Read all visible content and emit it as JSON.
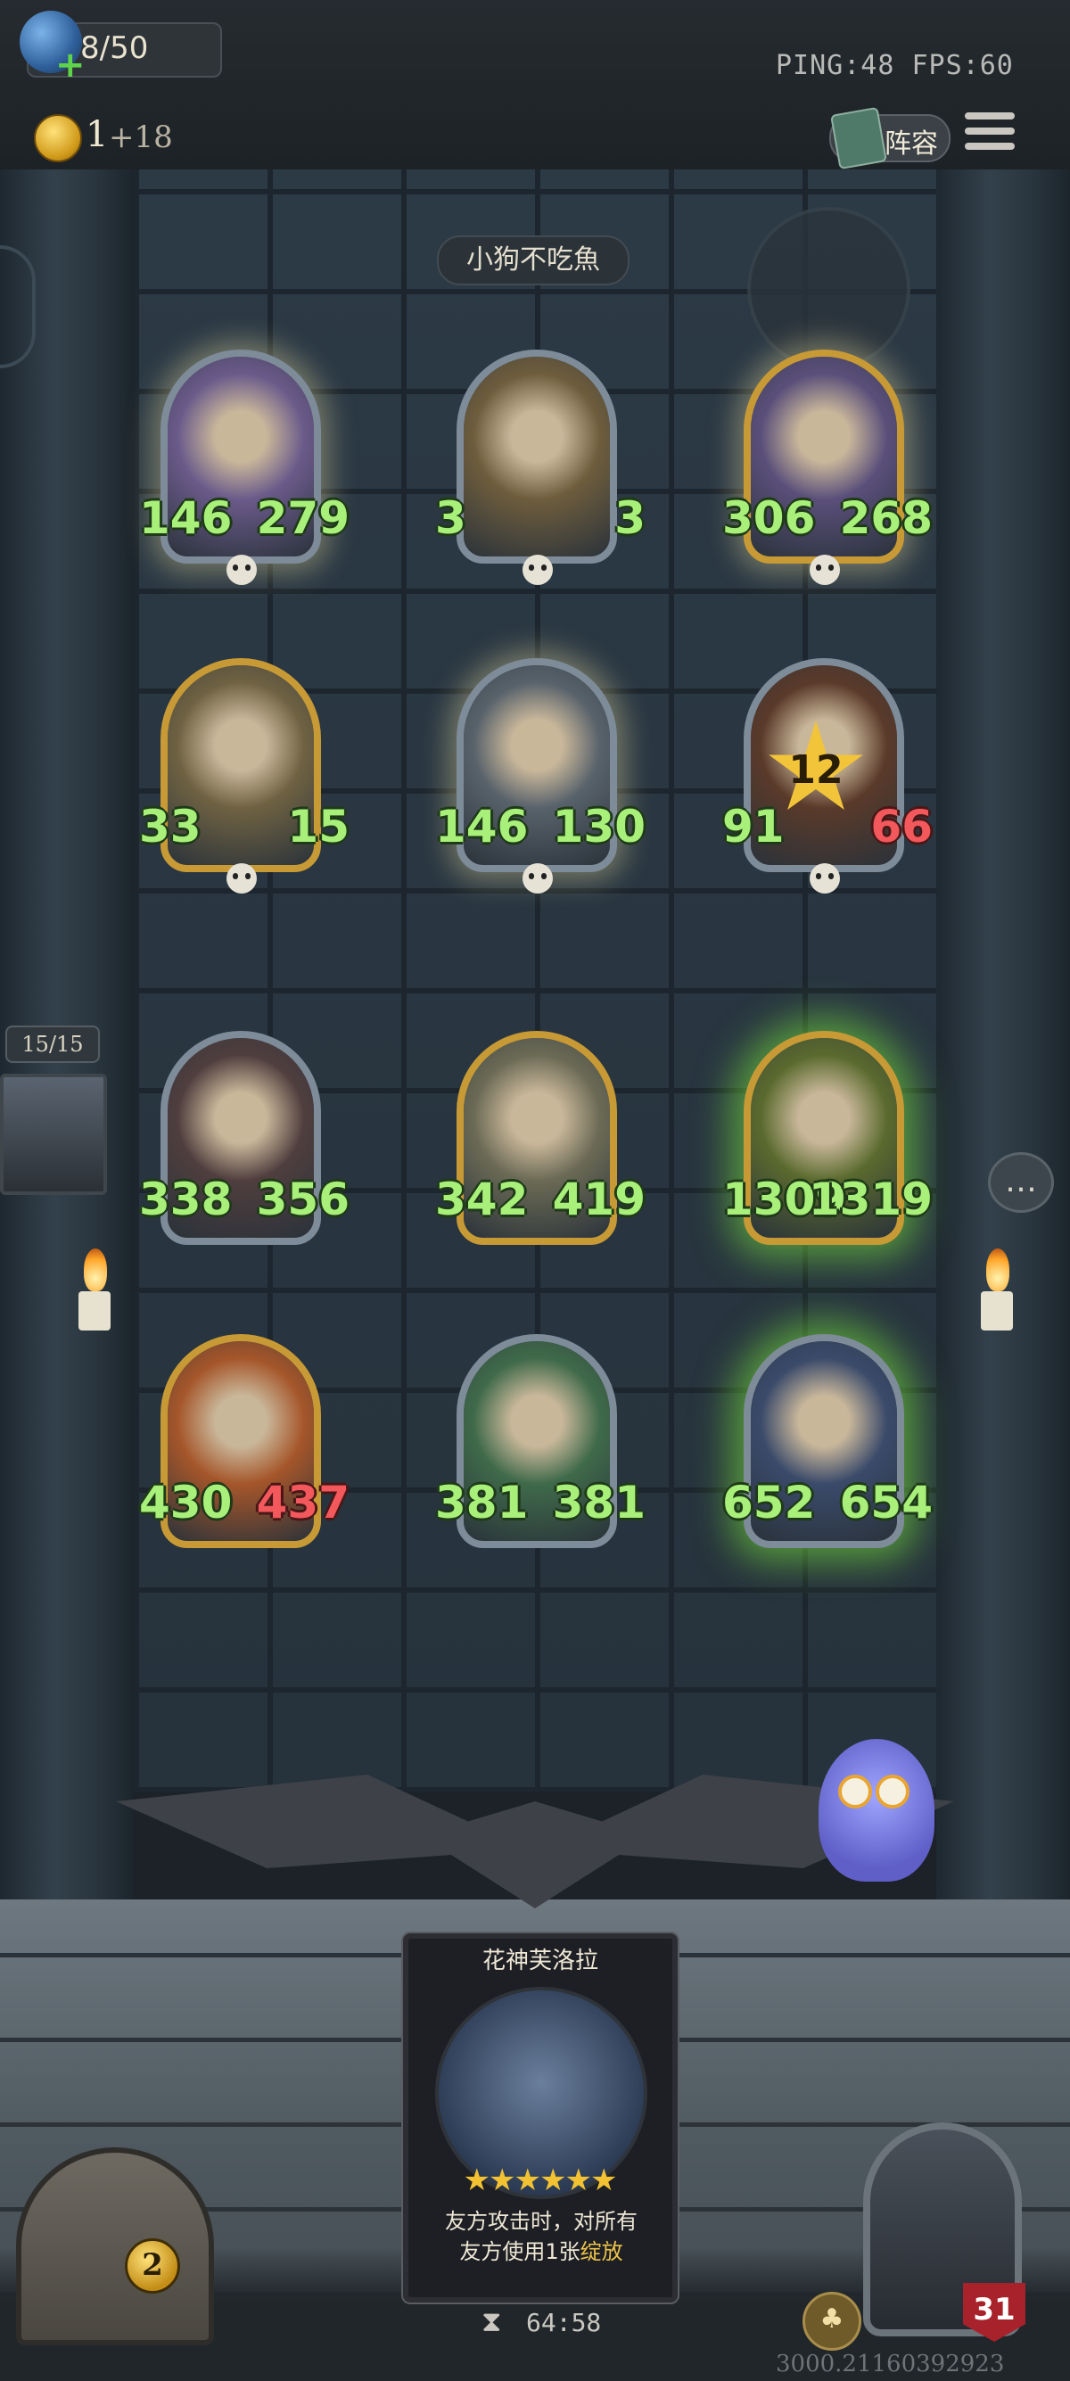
{
  "hud": {
    "energy": "8/50",
    "net_info": "PING:48   FPS:60",
    "coins": "1",
    "coin_bonus": "+18",
    "lineup_label": "阵容"
  },
  "opponent": {
    "name": "小狗不吃魚"
  },
  "board": {
    "units": [
      {
        "atk": "146",
        "hp": "279",
        "frame": "silver",
        "hurt": false
      },
      {
        "atk": "3",
        "hp": "3",
        "frame": "silver",
        "hurt": false
      },
      {
        "atk": "306",
        "hp": "268",
        "frame": "gold",
        "hurt": false
      },
      {
        "atk": "33",
        "hp": "15",
        "frame": "gold",
        "hurt": false
      },
      {
        "atk": "146",
        "hp": "130",
        "frame": "silver",
        "hurt": false
      },
      {
        "atk": "91",
        "hp": "66",
        "frame": "silver",
        "hurt": true,
        "star_level": "12"
      },
      {
        "atk": "338",
        "hp": "356",
        "frame": "silver",
        "hurt": false
      },
      {
        "atk": "342",
        "hp": "419",
        "frame": "gold",
        "hurt": false
      },
      {
        "atk": "1309",
        "hp": "1319",
        "frame": "gold",
        "hurt": false
      },
      {
        "atk": "430",
        "hp": "437",
        "frame": "gold",
        "hurt": true
      },
      {
        "atk": "381",
        "hp": "381",
        "frame": "silver",
        "hurt": false
      },
      {
        "atk": "652",
        "hp": "654",
        "frame": "silver",
        "hurt": false
      }
    ]
  },
  "side": {
    "counter": "15/15",
    "chat_icon": "chat-bubble-icon"
  },
  "card": {
    "name": "花神芙洛拉",
    "stars": "★★★★★★",
    "desc_line1": "友方攻击时，对所有",
    "desc_line2_prefix": "友方使用1张",
    "desc_keyword": "绽放"
  },
  "bottom": {
    "chest_count": "2",
    "timer": "64:58",
    "player_hp": "31",
    "seed": "3000.21160392923"
  }
}
